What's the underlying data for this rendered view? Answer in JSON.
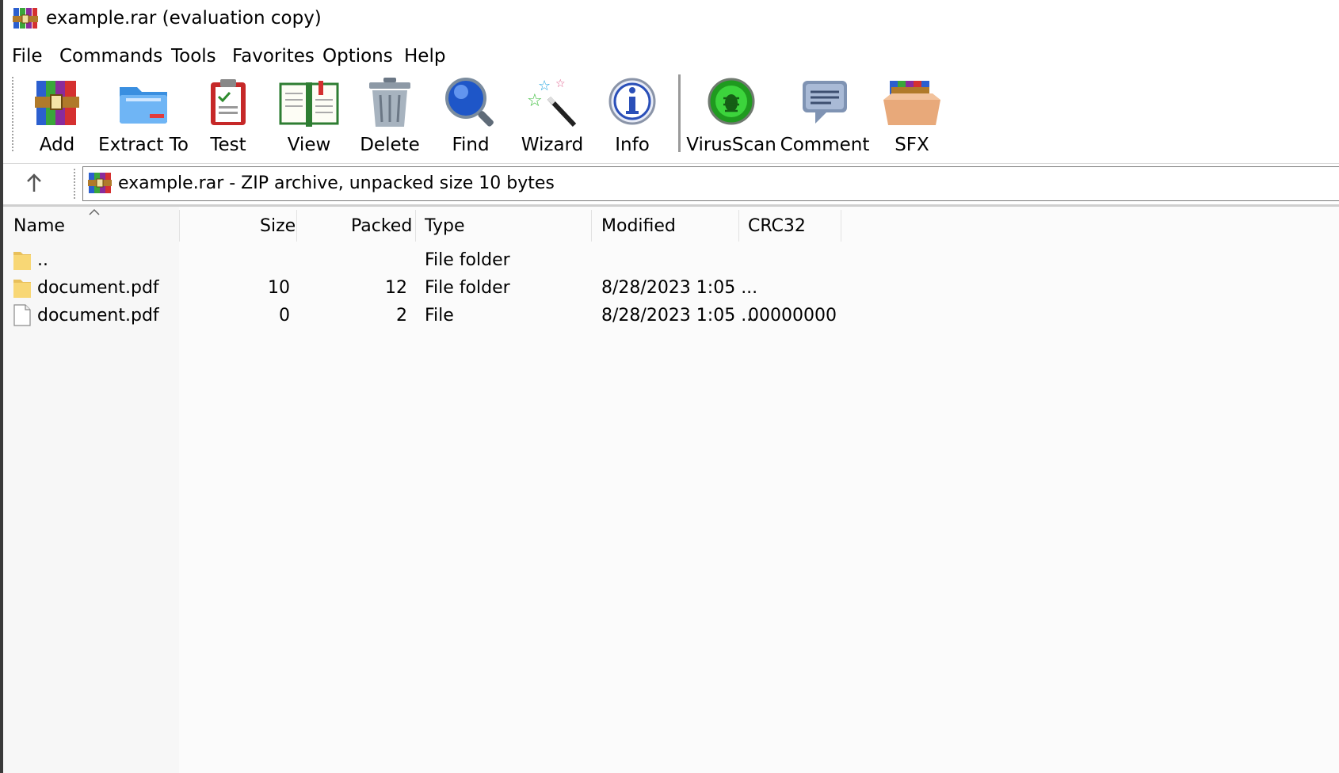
{
  "window": {
    "title": "example.rar (evaluation copy)",
    "app_icon": "winrar-icon"
  },
  "menu": {
    "items": [
      {
        "label": "File"
      },
      {
        "label": "Commands"
      },
      {
        "label": "Tools"
      },
      {
        "label": "Favorites"
      },
      {
        "label": "Options"
      },
      {
        "label": "Help"
      }
    ]
  },
  "toolbar": {
    "buttons": [
      {
        "label": "Add",
        "icon": "add-icon"
      },
      {
        "label": "Extract To",
        "icon": "extract-folder-icon"
      },
      {
        "label": "Test",
        "icon": "test-clipboard-icon"
      },
      {
        "label": "View",
        "icon": "book-icon"
      },
      {
        "label": "Delete",
        "icon": "trash-icon"
      },
      {
        "label": "Find",
        "icon": "magnifier-icon"
      },
      {
        "label": "Wizard",
        "icon": "magic-wand-icon"
      },
      {
        "label": "Info",
        "icon": "info-icon"
      },
      {
        "label": "VirusScan",
        "icon": "virus-scan-icon"
      },
      {
        "label": "Comment",
        "icon": "comment-icon"
      },
      {
        "label": "SFX",
        "icon": "sfx-box-icon"
      }
    ]
  },
  "address": {
    "text": "example.rar - ZIP archive, unpacked size 10 bytes",
    "up_icon": "up-arrow-icon"
  },
  "file_list": {
    "columns": {
      "name": "Name",
      "size": "Size",
      "packed": "Packed",
      "type": "Type",
      "modified": "Modified",
      "crc32": "CRC32"
    },
    "sort_indicator": "sort-ascending-caret-icon",
    "rows": [
      {
        "icon": "folder-icon",
        "name": "..",
        "size": "",
        "packed": "",
        "type": "File folder",
        "modified": "",
        "crc32": ""
      },
      {
        "icon": "folder-icon",
        "name": "document.pdf",
        "size": "10",
        "packed": "12",
        "type": "File folder",
        "modified": "8/28/2023 1:05 ...",
        "crc32": ""
      },
      {
        "icon": "file-icon",
        "name": "document.pdf",
        "size": "0",
        "packed": "2",
        "type": "File",
        "modified": "8/28/2023 1:05 ...",
        "crc32": "00000000"
      }
    ]
  },
  "colors": {
    "selection_column": "#f7f7f7",
    "background": "#fbfbfb",
    "folder": "#f8d775"
  }
}
